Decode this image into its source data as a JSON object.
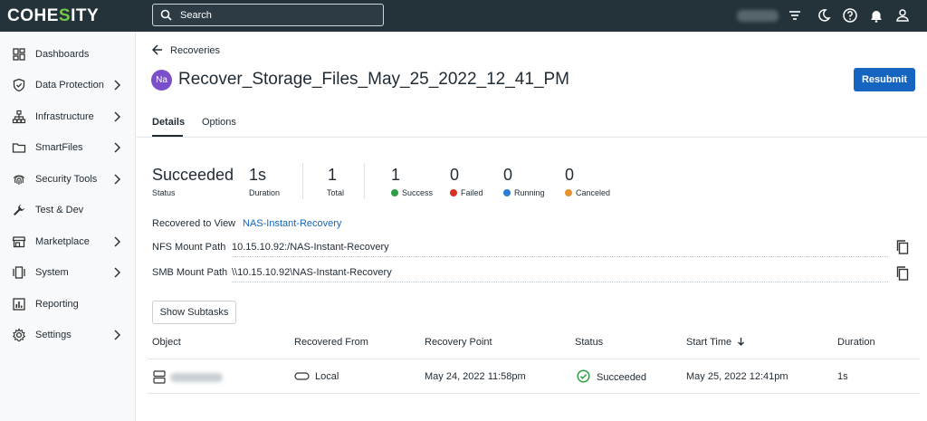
{
  "topbar": {
    "logo_pre": "COHE",
    "logo_accent": "S",
    "logo_post": "ITY",
    "search_placeholder": "Search",
    "icons": [
      "search-icon",
      "filter-icon",
      "moon-icon",
      "help-icon",
      "bell-icon",
      "user-icon"
    ]
  },
  "sidebar": {
    "items": [
      {
        "label": "Dashboards",
        "icon": "dashboard-icon",
        "chevron": false
      },
      {
        "label": "Data Protection",
        "icon": "shield-icon",
        "chevron": true
      },
      {
        "label": "Infrastructure",
        "icon": "hierarchy-icon",
        "chevron": true
      },
      {
        "label": "SmartFiles",
        "icon": "folder-icon",
        "chevron": true
      },
      {
        "label": "Security Tools",
        "icon": "fingerprint-icon",
        "chevron": true
      },
      {
        "label": "Test & Dev",
        "icon": "wrench-icon",
        "chevron": false
      },
      {
        "label": "Marketplace",
        "icon": "store-icon",
        "chevron": true
      },
      {
        "label": "System",
        "icon": "system-icon",
        "chevron": true
      },
      {
        "label": "Reporting",
        "icon": "report-icon",
        "chevron": false
      },
      {
        "label": "Settings",
        "icon": "gear-icon",
        "chevron": true
      }
    ]
  },
  "header": {
    "back_label": "Recoveries",
    "avatar": "Na",
    "title": "Recover_Storage_Files_May_25_2022_12_41_PM",
    "resubmit_label": "Resubmit"
  },
  "tabs": {
    "details": "Details",
    "options": "Options"
  },
  "stats": {
    "status_value": "Succeeded",
    "status_label": "Status",
    "duration_value": "1s",
    "duration_label": "Duration",
    "total_value": "1",
    "total_label": "Total",
    "success_value": "1",
    "success_label": "Success",
    "failed_value": "0",
    "failed_label": "Failed",
    "running_value": "0",
    "running_label": "Running",
    "canceled_value": "0",
    "canceled_label": "Canceled",
    "colors": {
      "success": "#2e9e44",
      "failed": "#d93025",
      "running": "#2a7fd4",
      "canceled": "#e8912d"
    }
  },
  "details": {
    "view_label": "Recovered to View",
    "view_value": "NAS-Instant-Recovery",
    "nfs_label": "NFS Mount Path",
    "nfs_value": "10.15.10.92:/NAS-Instant-Recovery",
    "smb_label": "SMB Mount Path",
    "smb_value": "\\\\10.15.10.92\\NAS-Instant-Recovery"
  },
  "show_subtasks_label": "Show Subtasks",
  "table": {
    "columns": {
      "object": "Object",
      "recovered_from": "Recovered From",
      "recovery_point": "Recovery Point",
      "status": "Status",
      "start_time": "Start Time",
      "duration": "Duration"
    },
    "rows": [
      {
        "recovered_from": "Local",
        "recovery_point": "May 24, 2022 11:58pm",
        "status": "Succeeded",
        "start_time": "May 25, 2022 12:41pm",
        "duration": "1s"
      }
    ]
  }
}
